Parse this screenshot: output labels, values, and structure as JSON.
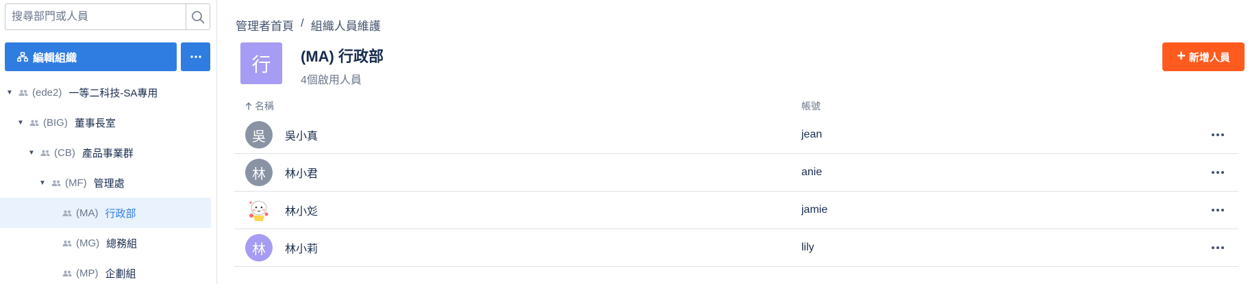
{
  "sidebar": {
    "search_placeholder": "搜尋部門或人員",
    "edit_label": "編輯組織",
    "tree": [
      {
        "code": "(ede2)",
        "name": "一等二科技-SA專用",
        "level": 0,
        "expanded": true,
        "selected": false
      },
      {
        "code": "(BIG)",
        "name": "董事長室",
        "level": 1,
        "expanded": true,
        "selected": false
      },
      {
        "code": "(CB)",
        "name": "產品事業群",
        "level": 2,
        "expanded": true,
        "selected": false
      },
      {
        "code": "(MF)",
        "name": "管理處",
        "level": 3,
        "expanded": true,
        "selected": false
      },
      {
        "code": "(MA)",
        "name": "行政部",
        "level": 4,
        "expanded": false,
        "selected": true
      },
      {
        "code": "(MG)",
        "name": "總務組",
        "level": 4,
        "expanded": false,
        "selected": false
      },
      {
        "code": "(MP)",
        "name": "企劃組",
        "level": 4,
        "expanded": false,
        "selected": false
      }
    ]
  },
  "breadcrumb": {
    "home": "管理者首頁",
    "separator": "/",
    "current": "組織人員維護"
  },
  "department": {
    "avatar_char": "行",
    "title": "(MA) 行政部",
    "subtitle": "4個啟用人員",
    "avatar_color": "#a79cf3"
  },
  "add_user_label": "新增人員",
  "table": {
    "col_name": "名稱",
    "col_account": "帳號",
    "rows": [
      {
        "avatar_char": "吳",
        "avatar_color": "#8993a4",
        "name": "吳小真",
        "account": "jean",
        "avatar_image": false
      },
      {
        "avatar_char": "林",
        "avatar_color": "#8993a4",
        "name": "林小君",
        "account": "anie",
        "avatar_image": false
      },
      {
        "avatar_char": "",
        "avatar_color": "#ffffff",
        "name": "林小彣",
        "account": "jamie",
        "avatar_image": true
      },
      {
        "avatar_char": "林",
        "avatar_color": "#a79cf3",
        "name": "林小莉",
        "account": "lily",
        "avatar_image": false
      }
    ]
  },
  "colors": {
    "primary": "#2f7de1",
    "accent": "#ff5b1f",
    "selected_bg": "#e9f2fd"
  },
  "icons": {
    "search": "search-icon",
    "org": "org-chart-icon",
    "more": "more-horizontal-icon",
    "group": "group-icon",
    "caret": "caret-down-icon",
    "sort": "arrow-up-icon",
    "plus": "plus-icon"
  }
}
